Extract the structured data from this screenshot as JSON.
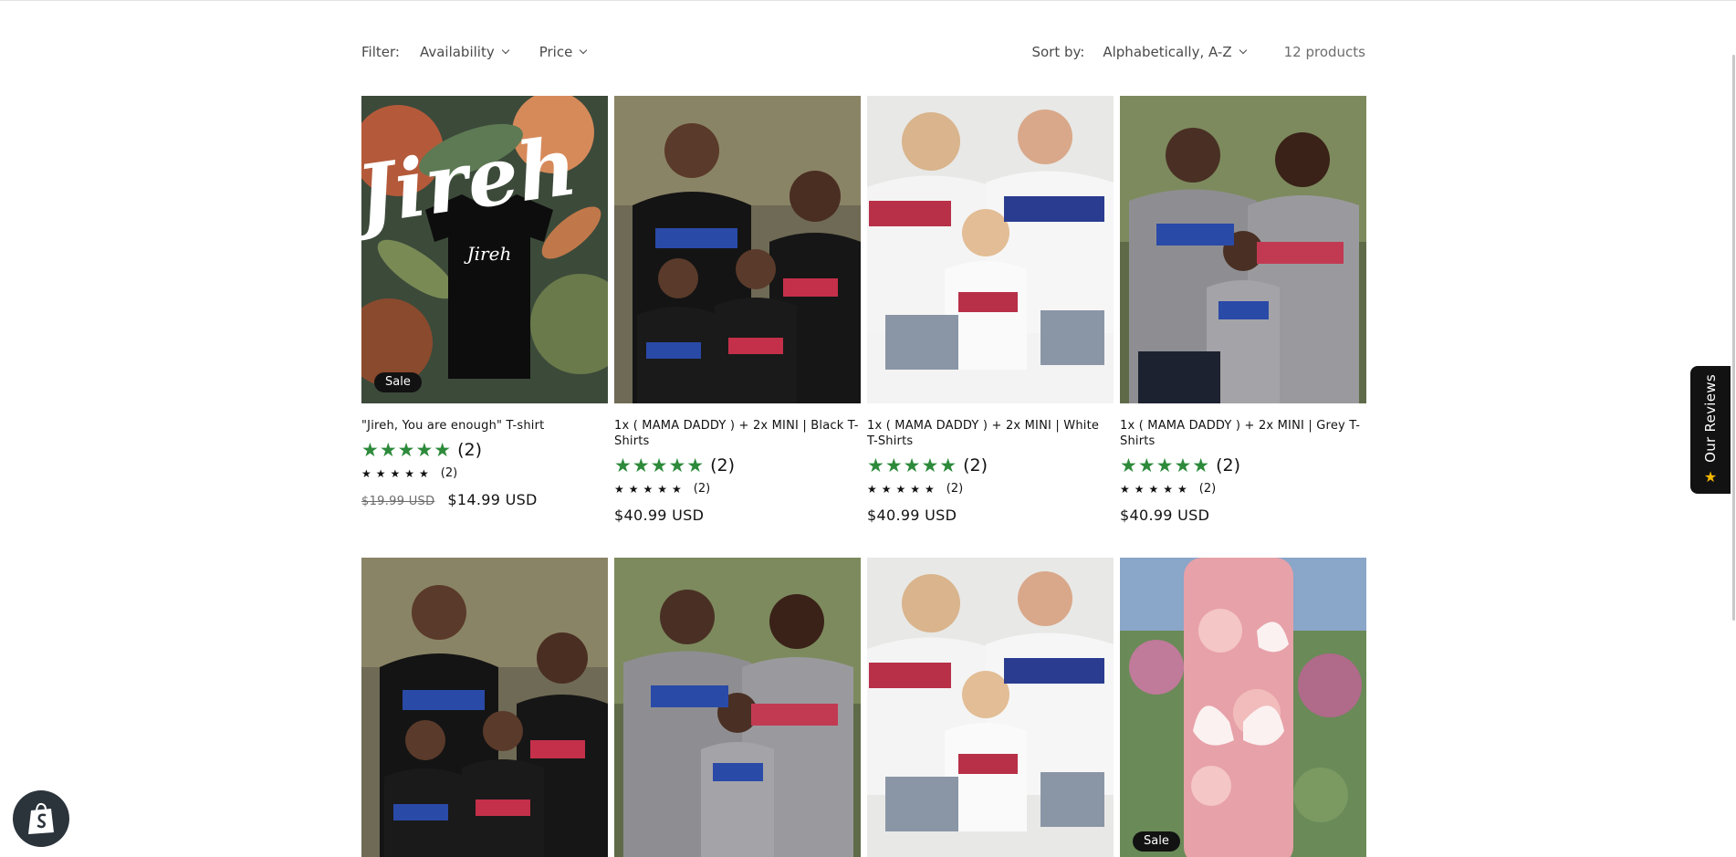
{
  "filter": {
    "label": "Filter:",
    "availability": "Availability",
    "price": "Price"
  },
  "sort": {
    "label": "Sort by:",
    "value": "Alphabetically, A-Z"
  },
  "product_count": "12 products",
  "products": [
    {
      "title": "\"Jireh, You are enough\" T-shirt",
      "rating_count": "(2)",
      "old_price": "$19.99 USD",
      "price": "$14.99 USD",
      "badge": "Sale",
      "image_text": "Jireh"
    },
    {
      "title": "1x ( MAMA DADDY ) + 2x MINI | Black T-Shirts",
      "rating_count": "(2)",
      "price": "$40.99 USD"
    },
    {
      "title": "1x ( MAMA DADDY ) + 2x MINI | White T-Shirts",
      "rating_count": "(2)",
      "price": "$40.99 USD"
    },
    {
      "title": "1x ( MAMA DADDY ) + 2x MINI | Grey T-Shirts",
      "rating_count": "(2)",
      "price": "$40.99 USD"
    },
    {
      "image": "family-black-tshirts"
    },
    {
      "image": "family-grey-tshirts"
    },
    {
      "image": "family-white-tshirts"
    },
    {
      "image": "pink-butterfly-tumbler",
      "badge": "Sale"
    }
  ],
  "stars_glyph": "★★★★★",
  "reviews_tab": {
    "label": "Our Reviews"
  },
  "colors": {
    "star_green": "#2d8a3b",
    "text": "#121212",
    "badge_bg": "#121212"
  }
}
